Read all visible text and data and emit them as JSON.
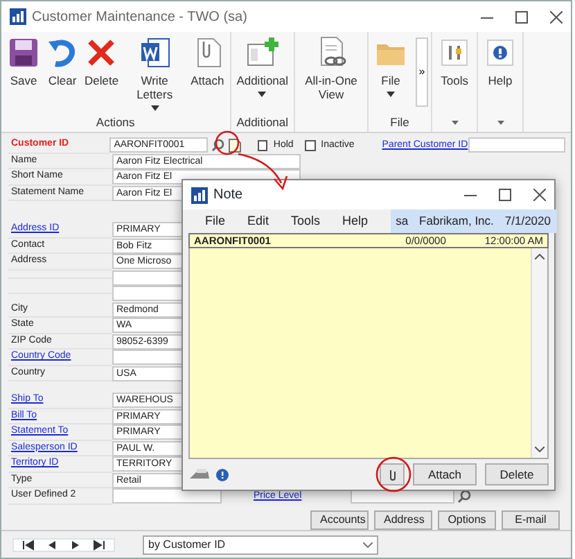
{
  "window": {
    "title": "Customer Maintenance  -  TWO (sa)"
  },
  "ribbon": {
    "groups": [
      {
        "label": "Actions",
        "buttons": [
          {
            "kind": "save",
            "label": "Save",
            "dropdown": false
          },
          {
            "kind": "clear",
            "label": "Clear",
            "dropdown": false
          },
          {
            "kind": "delete",
            "label": "Delete",
            "dropdown": false
          },
          {
            "kind": "letters",
            "label": "Write Letters",
            "dropdown": true
          },
          {
            "kind": "attach",
            "label": "Attach",
            "dropdown": false
          }
        ]
      },
      {
        "label": "Additional",
        "buttons": [
          {
            "kind": "additional",
            "label": "Additional",
            "dropdown": true
          }
        ]
      },
      {
        "buttons": [
          {
            "kind": "allinone",
            "label": "All-in-One View",
            "dropdown": false
          }
        ]
      },
      {
        "label": "File",
        "buttons": [
          {
            "kind": "file",
            "label": "File",
            "dropdown": true
          }
        ],
        "overflow": "»"
      },
      {
        "caret": true,
        "buttons": [
          {
            "kind": "tools",
            "label": "Tools",
            "dropdown": false
          }
        ]
      },
      {
        "caret": true,
        "buttons": [
          {
            "kind": "help",
            "label": "Help",
            "dropdown": false
          }
        ]
      }
    ]
  },
  "header": {
    "customer_id": {
      "label": "Customer ID",
      "value": "AARONFIT0001"
    },
    "hold": {
      "label": "Hold",
      "checked": false
    },
    "inactive": {
      "label": "Inactive",
      "checked": false
    },
    "parent_customer_id": {
      "label": "Parent Customer ID"
    }
  },
  "field_groups": [
    [
      {
        "kind": "field",
        "label": "Name",
        "value": "Aaron Fitz Electrical",
        "link": false
      },
      {
        "kind": "field",
        "label": "Short Name",
        "value": "Aaron Fitz El",
        "link": false
      },
      {
        "kind": "field",
        "label": "Statement Name",
        "value": "Aaron Fitz El",
        "link": false
      }
    ],
    [
      {
        "kind": "field",
        "label": "Address ID",
        "value": "PRIMARY",
        "link": true
      },
      {
        "kind": "field",
        "label": "Contact",
        "value": "Bob Fitz",
        "link": false
      },
      {
        "kind": "field",
        "label": "Address",
        "value": "One Microso",
        "link": false
      },
      {
        "kind": "continuation"
      },
      {
        "kind": "continuation"
      },
      {
        "kind": "field",
        "label": "City",
        "value": "Redmond",
        "link": false
      },
      {
        "kind": "field",
        "label": "State",
        "value": "WA",
        "link": false
      },
      {
        "kind": "field",
        "label": "ZIP Code",
        "value": "98052-6399",
        "link": false
      },
      {
        "kind": "field",
        "label": "Country Code",
        "link": true
      },
      {
        "kind": "field",
        "label": "Country",
        "value": "USA",
        "link": false
      }
    ],
    [
      {
        "kind": "field",
        "label": "Ship To",
        "value": "WAREHOUS",
        "link": true
      },
      {
        "kind": "field",
        "label": "Bill To",
        "value": "PRIMARY",
        "link": true
      },
      {
        "kind": "field",
        "label": "Statement To",
        "value": "PRIMARY",
        "link": true
      },
      {
        "kind": "field",
        "label": "Salesperson ID",
        "value": "PAUL W.",
        "link": true
      },
      {
        "kind": "field",
        "label": "Territory ID",
        "value": "TERRITORY",
        "link": true
      },
      {
        "kind": "field",
        "label": "Type",
        "value": "Retail",
        "link": false
      },
      {
        "kind": "field",
        "label": "User Defined 2",
        "link": false
      }
    ]
  ],
  "price_level": {
    "label": "Price Level"
  },
  "buttons": [
    "Accounts",
    "Address",
    "Options",
    "E-mail"
  ],
  "sort": {
    "value": "by Customer ID"
  },
  "note": {
    "title": "Note",
    "menu": [
      "File",
      "Edit",
      "Tools",
      "Help"
    ],
    "status": {
      "user": "sa",
      "company": "Fabrikam, Inc.",
      "date": "7/1/2020"
    },
    "header": {
      "id": "AARONFIT0001",
      "date": "0/0/0000",
      "time": "12:00:00 AM"
    },
    "buttons": [
      "Attach",
      "Delete"
    ]
  }
}
